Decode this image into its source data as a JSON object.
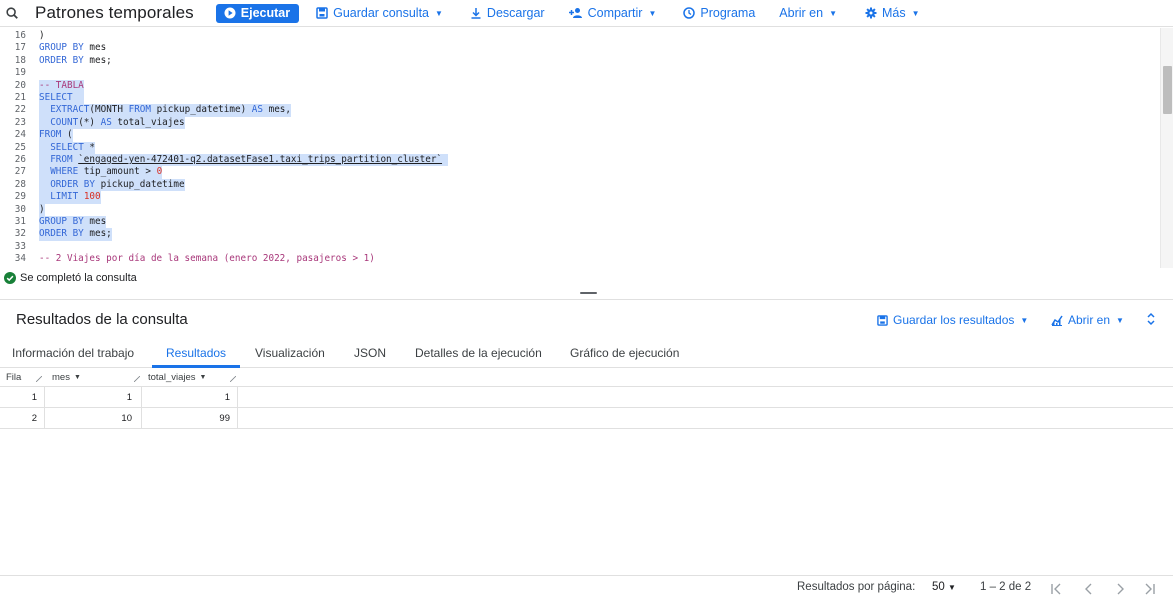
{
  "toolbar": {
    "title": "Patrones temporales",
    "run_label": "Ejecutar",
    "save_query_label": "Guardar consulta",
    "download_label": "Descargar",
    "share_label": "Compartir",
    "schedule_label": "Programa",
    "open_in_label": "Abrir en",
    "more_label": "Más"
  },
  "editor": {
    "lines": [
      {
        "n": "16",
        "text": ")"
      },
      {
        "n": "17",
        "text": "GROUP BY mes"
      },
      {
        "n": "18",
        "text": "ORDER BY mes;"
      },
      {
        "n": "19",
        "text": ""
      },
      {
        "n": "20",
        "text": "-- TABLA"
      },
      {
        "n": "21",
        "text": "SELECT"
      },
      {
        "n": "22",
        "text": "  EXTRACT(MONTH FROM pickup_datetime) AS mes,"
      },
      {
        "n": "23",
        "text": "  COUNT(*) AS total_viajes"
      },
      {
        "n": "24",
        "text": "FROM ("
      },
      {
        "n": "25",
        "text": "  SELECT *"
      },
      {
        "n": "26",
        "text": "  FROM `engaged-yen-472401-q2.datasetFase1.taxi_trips_partition_cluster`"
      },
      {
        "n": "27",
        "text": "  WHERE tip_amount > 0"
      },
      {
        "n": "28",
        "text": "  ORDER BY pickup_datetime"
      },
      {
        "n": "29",
        "text": "  LIMIT 100"
      },
      {
        "n": "30",
        "text": ")"
      },
      {
        "n": "31",
        "text": "GROUP BY mes"
      },
      {
        "n": "32",
        "text": "ORDER BY mes;"
      },
      {
        "n": "33",
        "text": ""
      },
      {
        "n": "34",
        "text": "-- 2 Viajes por día de la semana (enero 2022, pasajeros > 1)"
      }
    ]
  },
  "status": {
    "text": "Se completó la consulta"
  },
  "results": {
    "title": "Resultados de la consulta",
    "save_results_label": "Guardar los resultados",
    "open_in_label": "Abrir en"
  },
  "tabs": [
    {
      "label": "Información del trabajo"
    },
    {
      "label": "Resultados"
    },
    {
      "label": "Visualización"
    },
    {
      "label": "JSON"
    },
    {
      "label": "Detalles de la ejecución"
    },
    {
      "label": "Gráfico de ejecución"
    }
  ],
  "table": {
    "headers": {
      "row": "Fila",
      "col1": "mes",
      "col2": "total_viajes"
    },
    "rows": [
      {
        "fila": "1",
        "mes": "1",
        "total_viajes": "1"
      },
      {
        "fila": "2",
        "mes": "10",
        "total_viajes": "99"
      }
    ]
  },
  "pagination": {
    "per_page_label": "Resultados por página:",
    "per_page_value": "50",
    "range": "1 – 2 de 2"
  },
  "colors": {
    "accent": "#1a73e8",
    "keyword": "#3367d6",
    "comment": "#a8377a",
    "highlight": "#cfe0fa",
    "success": "#188038"
  }
}
